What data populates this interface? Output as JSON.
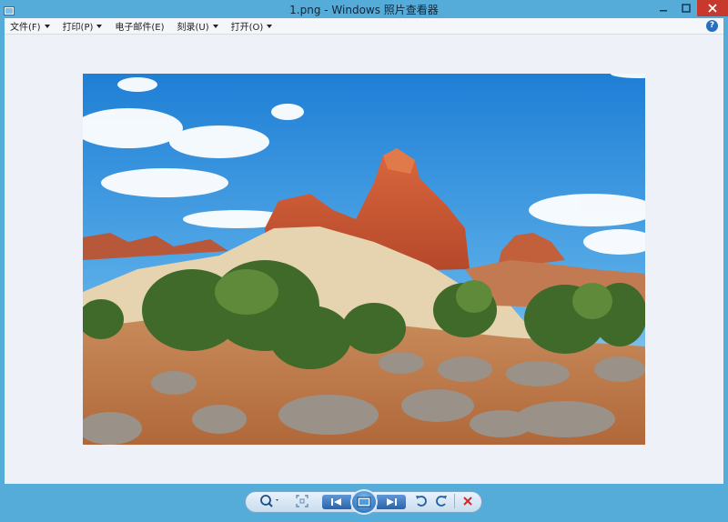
{
  "window": {
    "title": "1.png - Windows 照片查看器"
  },
  "menu": {
    "items": [
      {
        "label": "文件(F)"
      },
      {
        "label": "打印(P)"
      },
      {
        "label": "电子邮件(E)"
      },
      {
        "label": "刻录(U)"
      },
      {
        "label": "打开(O)"
      }
    ],
    "help_label": "?"
  },
  "photo": {
    "subject": "desert sandstone rock formations under blue sky"
  },
  "controls": {
    "icons": [
      "zoom-icon",
      "fit-window-icon",
      "previous-icon",
      "slideshow-icon",
      "next-icon",
      "rotate-counterclockwise-icon",
      "rotate-clockwise-icon",
      "delete-icon"
    ]
  },
  "colors": {
    "frame": "#56acd9",
    "close": "#c7382d",
    "viewer_bg": "#eef1f7",
    "sky": "#2f8ee0"
  }
}
